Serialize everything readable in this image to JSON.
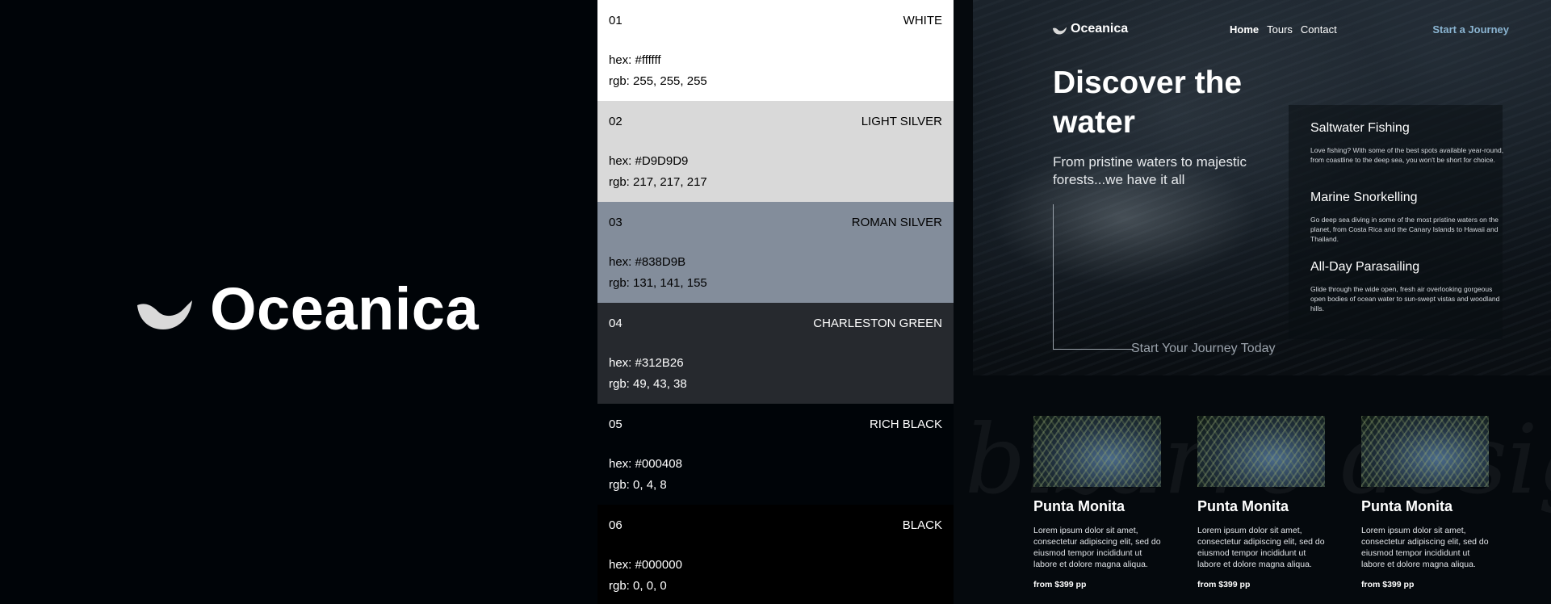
{
  "brand": {
    "name": "Oceanica",
    "logo_icon": "wave-drop-icon",
    "logo_color": "#D9D9D9"
  },
  "palette": [
    {
      "num": "01",
      "name": "WHITE",
      "hex": "hex: #ffffff",
      "rgb": "rgb: 255, 255, 255",
      "color": "#ffffff",
      "text_color": "#000000"
    },
    {
      "num": "02",
      "name": "LIGHT SILVER",
      "hex": "hex: #D9D9D9",
      "rgb": "rgb: 217, 217, 217",
      "color": "#D9D9D9",
      "text_color": "#000000"
    },
    {
      "num": "03",
      "name": "ROMAN SILVER",
      "hex": "hex: #838D9B",
      "rgb": "rgb: 131, 141, 155",
      "color": "#838D9B",
      "text_color": "#000000"
    },
    {
      "num": "04",
      "name": "CHARLESTON GREEN",
      "hex": "hex: #312B26",
      "rgb": "rgb: 49, 43, 38",
      "color": "#26292e",
      "text_color": "#ffffff"
    },
    {
      "num": "05",
      "name": "RICH BLACK",
      "hex": "hex: #000408",
      "rgb": "rgb: 0, 4, 8",
      "color": "#000408",
      "text_color": "#ffffff"
    },
    {
      "num": "06",
      "name": "BLACK",
      "hex": "hex: #000000",
      "rgb": "rgb: 0, 0, 0",
      "color": "#000000",
      "text_color": "#ffffff"
    }
  ],
  "site": {
    "nav": {
      "brand": "Oceanica",
      "links": [
        "Home",
        "Tours",
        "Contact"
      ],
      "cta": "Start a Journey",
      "cta_color": "#8ab4d1"
    },
    "hero": {
      "title": "Discover the water",
      "subtitle": "From pristine waters to majestic forests...we have it all",
      "journey_label": "Start Your Journey Today"
    },
    "services": [
      {
        "title": "Saltwater Fishing",
        "desc": "Love fishing? With some of the best spots available year-round, from coastline to the deep sea, you won't be short for choice."
      },
      {
        "title": "Marine Snorkelling",
        "desc": "Go deep sea diving in some of the most pristine waters on the planet, from Costa Rica and the Canary Islands to Hawaii and Thailand."
      },
      {
        "title": "All-Day Parasailing",
        "desc": "Glide through the wide open, fresh air overlooking gorgeous open bodies of ocean water to sun-swept vistas and woodland hills."
      }
    ],
    "watermark": "bizarre design at",
    "tours": [
      {
        "title": "Punta Monita",
        "desc": "Lorem ipsum dolor sit amet, consectetur adipiscing elit, sed do eiusmod tempor incididunt ut labore et dolore magna aliqua.",
        "price": "from $399 pp"
      },
      {
        "title": "Punta Monita",
        "desc": "Lorem ipsum dolor sit amet, consectetur adipiscing elit, sed do eiusmod tempor incididunt ut labore et dolore magna aliqua.",
        "price": "from $399 pp"
      },
      {
        "title": "Punta Monita",
        "desc": "Lorem ipsum dolor sit amet, consectetur adipiscing elit, sed do eiusmod tempor incididunt ut labore et dolore magna aliqua.",
        "price": "from $399 pp"
      }
    ]
  }
}
